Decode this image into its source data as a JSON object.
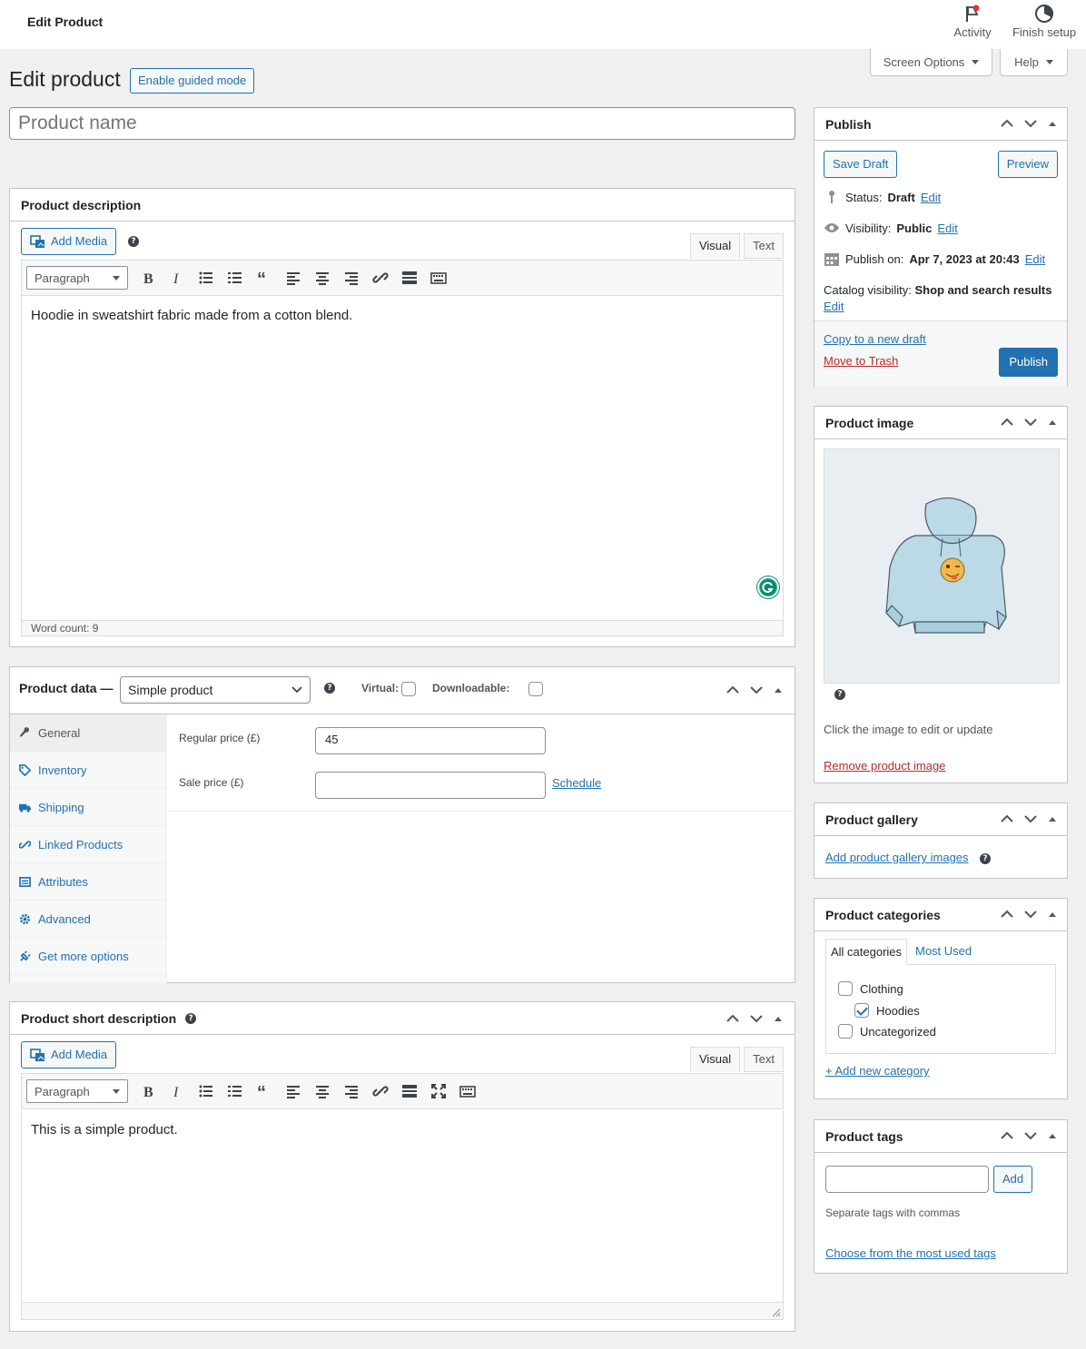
{
  "topbar": {
    "title": "Edit Product",
    "activity": "Activity",
    "finish_setup": "Finish setup"
  },
  "screen_options": "Screen Options",
  "help": "Help",
  "page_title": "Edit product",
  "guided_mode": "Enable guided mode",
  "product_name_placeholder": "Product name",
  "description": {
    "heading": "Product description",
    "add_media": "Add Media",
    "tab_visual": "Visual",
    "tab_text": "Text",
    "format": "Paragraph",
    "content": "Hoodie in sweatshirt fabric made from a cotton blend.",
    "word_count": "Word count: 9"
  },
  "product_data": {
    "heading": "Product data —",
    "type": "Simple product",
    "virtual": "Virtual:",
    "downloadable": "Downloadable:",
    "nav": [
      {
        "label": "General",
        "icon": "wrench-icon"
      },
      {
        "label": "Inventory",
        "icon": "tag-icon"
      },
      {
        "label": "Shipping",
        "icon": "truck-icon"
      },
      {
        "label": "Linked Products",
        "icon": "link-icon"
      },
      {
        "label": "Attributes",
        "icon": "list-icon"
      },
      {
        "label": "Advanced",
        "icon": "gear-icon"
      },
      {
        "label": "Get more options",
        "icon": "plugin-icon"
      }
    ],
    "regular_price_label": "Regular price (£)",
    "regular_price": "45",
    "sale_price_label": "Sale price (£)",
    "sale_price": "",
    "schedule": "Schedule"
  },
  "short_description": {
    "heading": "Product short description",
    "add_media": "Add Media",
    "tab_visual": "Visual",
    "tab_text": "Text",
    "format": "Paragraph",
    "content": "This is a simple product."
  },
  "publish": {
    "heading": "Publish",
    "save_draft": "Save Draft",
    "preview": "Preview",
    "status_label": "Status:",
    "status_value": "Draft",
    "edit": "Edit",
    "visibility_label": "Visibility:",
    "visibility_value": "Public",
    "publish_on_label": "Publish on:",
    "publish_on_value": "Apr 7, 2023 at 20:43",
    "catalog_label": "Catalog visibility:",
    "catalog_value": "Shop and search results",
    "copy_draft": "Copy to a new draft",
    "trash": "Move to Trash",
    "publish_btn": "Publish"
  },
  "product_image": {
    "heading": "Product image",
    "hint": "Click the image to edit or update",
    "remove": "Remove product image"
  },
  "gallery": {
    "heading": "Product gallery",
    "add": "Add product gallery images"
  },
  "categories": {
    "heading": "Product categories",
    "tab_all": "All categories",
    "tab_most": "Most Used",
    "items": [
      {
        "label": "Clothing",
        "checked": false
      },
      {
        "label": "Hoodies",
        "checked": true
      },
      {
        "label": "Uncategorized",
        "checked": false
      }
    ],
    "add_new": "+ Add new category"
  },
  "tags": {
    "heading": "Product tags",
    "add": "Add",
    "hint": "Separate tags with commas",
    "choose": "Choose from the most used tags"
  },
  "colors": {
    "accent": "#2271b1",
    "trash": "#b32d2e",
    "background": "#f0f0f1"
  }
}
